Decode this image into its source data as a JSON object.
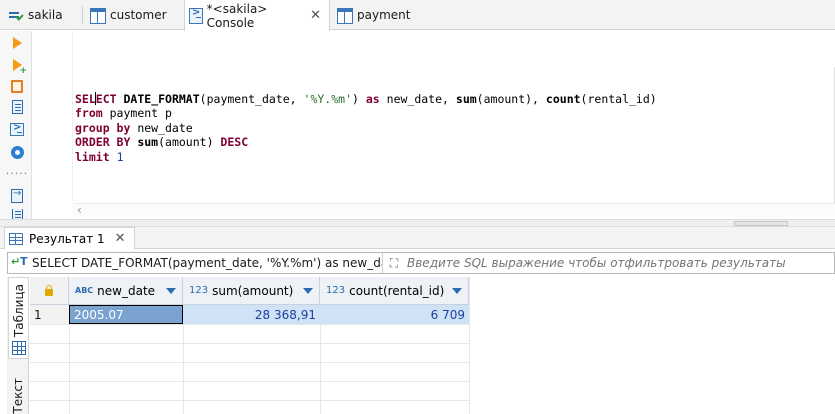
{
  "tabs": [
    {
      "label": "sakila",
      "icon": "sql-script-icon"
    },
    {
      "label": "customer",
      "icon": "table-icon"
    },
    {
      "label": "*<sakila> Console",
      "icon": "console-icon"
    },
    {
      "label": "payment",
      "icon": "table-icon"
    }
  ],
  "toolbar": {
    "icons": [
      "execute-statement-icon",
      "execute-script-icon",
      "explain-plan-icon",
      "open-file-icon",
      "console-icon",
      "settings-icon",
      "more-icon",
      "export-icon",
      "open-icon"
    ]
  },
  "editor": {
    "lines": [
      "SELECT DATE_FORMAT(payment_date, '%Y.%m') as new_date, sum(amount), count(rental_id)",
      "from payment p",
      "group by new_date",
      "ORDER BY sum(amount) DESC",
      "limit 1"
    ]
  },
  "results": {
    "tab_label": "Результат 1",
    "query_text": "SELECT DATE_FORMAT(payment_date, '%Y.%m') as new_date, sum",
    "filter_placeholder": "Введите SQL выражение чтобы отфильтровать результаты",
    "side_tabs": [
      "Таблица",
      "Текст"
    ],
    "columns": [
      {
        "type": "ABC",
        "name": "new_date"
      },
      {
        "type": "123",
        "name": "sum(amount)"
      },
      {
        "type": "123",
        "name": "count(rental_id)"
      }
    ],
    "rows": [
      {
        "num": "1",
        "cells": [
          "2005.07",
          "28 368,91",
          "6 709"
        ]
      }
    ]
  },
  "colors": {
    "keyword": "#7f0033",
    "string": "#2a6f2a",
    "number": "#1c3fa3",
    "selection": "#cfe2f6",
    "header_bg": "#eef1f5"
  }
}
